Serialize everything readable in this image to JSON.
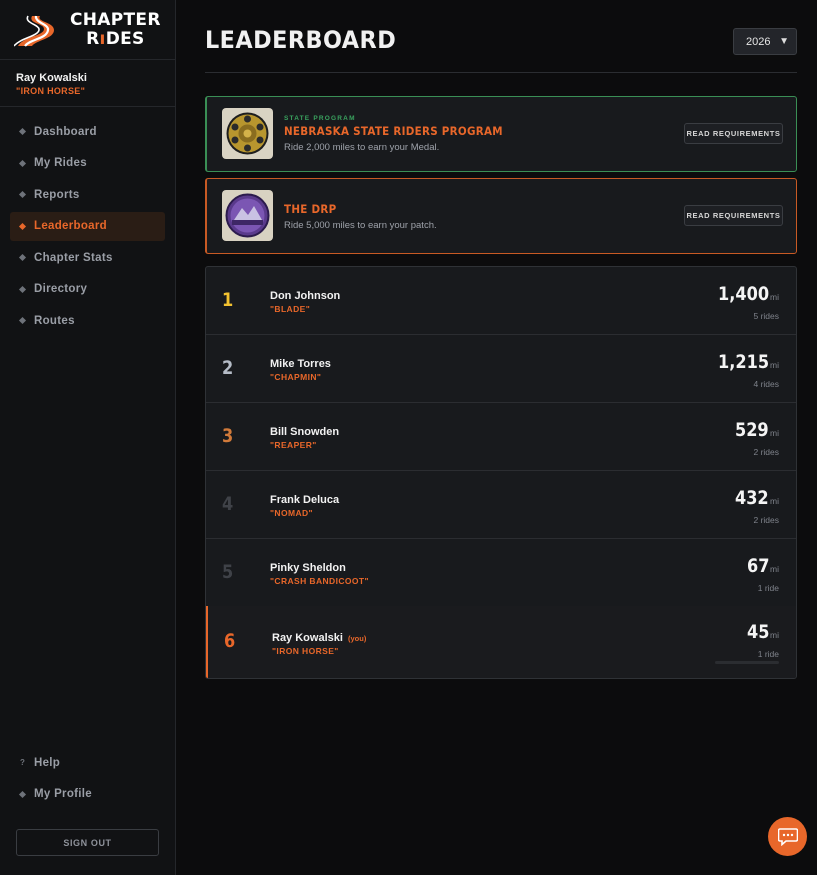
{
  "brand": {
    "line1": "CHAPTER",
    "line2a": "R",
    "line2b": "DES"
  },
  "user": {
    "name": "Ray Kowalski",
    "nickname": "\"IRON HORSE\""
  },
  "nav": [
    {
      "label": "Dashboard",
      "active": false
    },
    {
      "label": "My Rides",
      "active": false
    },
    {
      "label": "Reports",
      "active": false
    },
    {
      "label": "Leaderboard",
      "active": true
    },
    {
      "label": "Chapter Stats",
      "active": false
    },
    {
      "label": "Directory",
      "active": false
    },
    {
      "label": "Routes",
      "active": false
    }
  ],
  "bottom_nav": {
    "help": "Help",
    "profile": "My Profile"
  },
  "sign_out": "SIGN OUT",
  "page": {
    "title": "LEADERBOARD",
    "year": "2026"
  },
  "programs": [
    {
      "tag": "STATE PROGRAM",
      "title": "NEBRASKA STATE RIDERS PROGRAM",
      "desc": "Ride 2,000 miles to earn your Medal.",
      "button": "READ REQUIREMENTS"
    },
    {
      "tag": "",
      "title": "THE DRP",
      "desc": "Ride 5,000 miles to earn your patch.",
      "button": "READ REQUIREMENTS"
    }
  ],
  "leaderboard": [
    {
      "rank": "1",
      "name": "Don Johnson",
      "nick": "\"BLADE\"",
      "miles": "1,400",
      "unit": "mi",
      "rides": "5 rides",
      "color": "#f2c230"
    },
    {
      "rank": "2",
      "name": "Mike Torres",
      "nick": "\"CHAPMIN\"",
      "miles": "1,215",
      "unit": "mi",
      "rides": "4 rides",
      "color": "#b5bcc7"
    },
    {
      "rank": "3",
      "name": "Bill Snowden",
      "nick": "\"REAPER\"",
      "miles": "529",
      "unit": "mi",
      "rides": "2 rides",
      "color": "#d17a3a"
    },
    {
      "rank": "4",
      "name": "Frank Deluca",
      "nick": "\"NOMAD\"",
      "miles": "432",
      "unit": "mi",
      "rides": "2 rides",
      "color": "#3f4248"
    },
    {
      "rank": "5",
      "name": "Pinky Sheldon",
      "nick": "\"CRASH BANDICOOT\"",
      "miles": "67",
      "unit": "mi",
      "rides": "1 ride",
      "color": "#3f4248"
    },
    {
      "rank": "6",
      "name": "Ray Kowalski",
      "you": "(you)",
      "nick": "\"IRON HORSE\"",
      "miles": "45",
      "unit": "mi",
      "rides": "1 ride",
      "color": "#e8672a"
    }
  ],
  "colors": {
    "accent": "#e8672a",
    "green": "#3aa35f",
    "background": "#0c0c0d"
  }
}
